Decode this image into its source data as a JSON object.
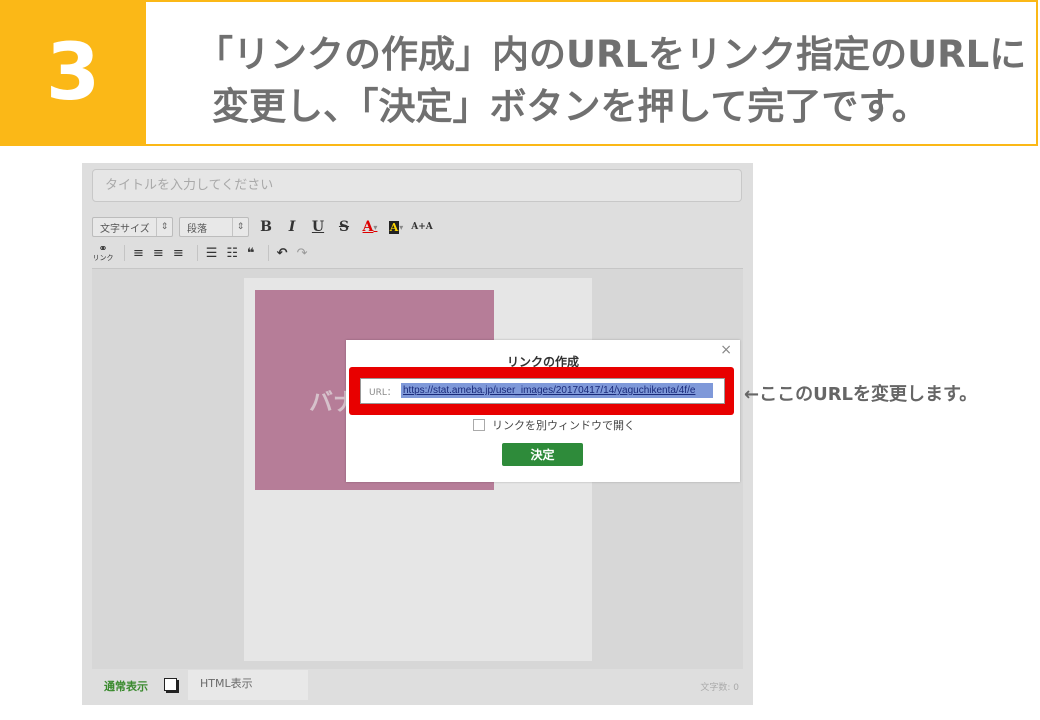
{
  "step": {
    "number": "3",
    "line1": "「リンクの作成」内のURLをリンク指定のURLに",
    "line2": "変更し、「決定」ボタンを押して完了です。"
  },
  "editor": {
    "title_placeholder": "タイトルを入力してください",
    "toolbar": {
      "font_size": "文字サイズ",
      "paragraph": "段落",
      "bold": "B",
      "italic": "I",
      "underline": "U",
      "strike": "S",
      "font_color": "A",
      "bg_color": "A",
      "plus_minus": "A+A",
      "link_label": "リンク"
    },
    "image_text": "バナ",
    "bottom": {
      "normal_view": "通常表示",
      "html_view": "HTML表示",
      "char_count": "文字数: 0"
    }
  },
  "dialog": {
    "title": "リンクの作成",
    "close": "×",
    "url_label": "URL：",
    "url_value": "https://stat.ameba.jp/user_images/20170417/14/yaguchikenta/4f/e",
    "new_window_label": "リンクを別ウィンドウで開く",
    "decide_label": "決定"
  },
  "annotation": "←ここのURLを変更します。",
  "colors": {
    "accent": "#fbb817",
    "highlight_frame": "#e80000",
    "decide_button": "#2e8b3a",
    "image": "#b67d98"
  }
}
